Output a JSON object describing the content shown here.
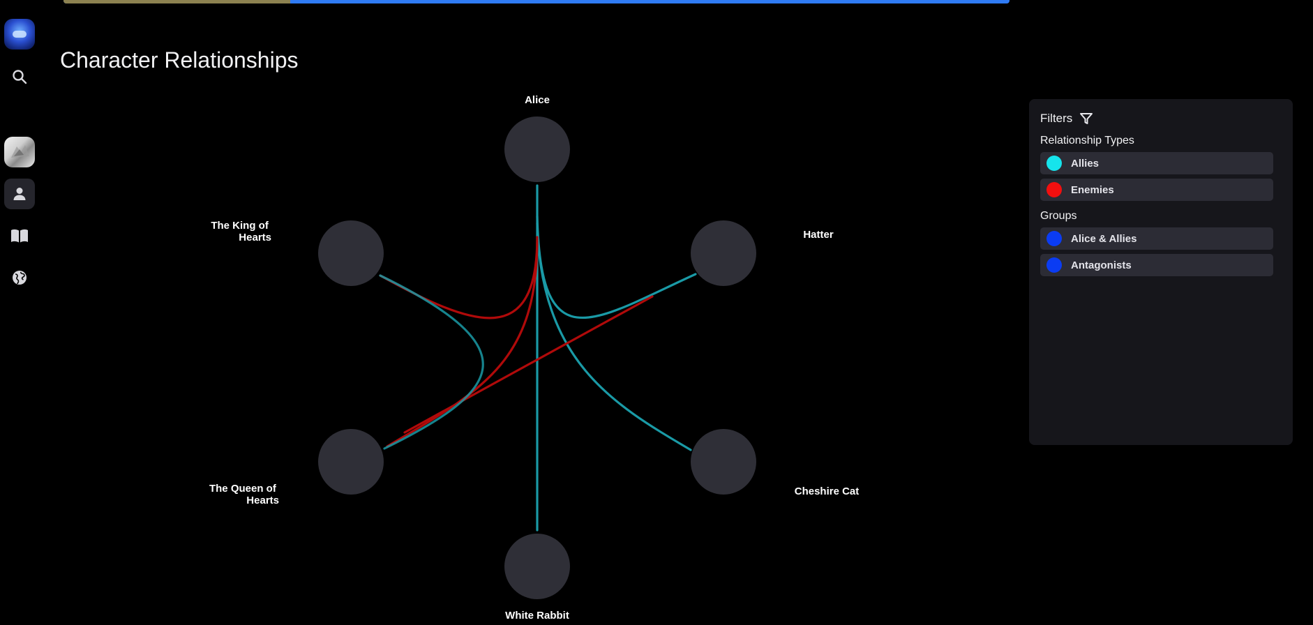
{
  "progress": {
    "value": 0.24,
    "colors": {
      "done": "#8c8150",
      "remaining": "#2f7bf5"
    }
  },
  "sidebar": {
    "items": [
      {
        "icon": "app-logo",
        "active": false
      },
      {
        "icon": "search-icon",
        "active": false
      },
      {
        "icon": "avatar-image",
        "active": false
      },
      {
        "icon": "user-icon",
        "active": true
      },
      {
        "icon": "book-icon",
        "active": false
      },
      {
        "icon": "globe-icon",
        "active": false
      }
    ]
  },
  "page": {
    "title": "Character Relationships"
  },
  "graph": {
    "nodes": [
      {
        "id": "alice",
        "label": "Alice"
      },
      {
        "id": "hatter",
        "label": "Hatter"
      },
      {
        "id": "cheshire",
        "label": "Cheshire Cat"
      },
      {
        "id": "rabbit",
        "label": "White Rabbit"
      },
      {
        "id": "queen",
        "label_lines": [
          "The Queen of",
          "Hearts"
        ]
      },
      {
        "id": "king",
        "label_lines": [
          "The King of",
          "Hearts"
        ]
      }
    ],
    "edges": [
      {
        "from": "alice",
        "to": "rabbit",
        "type": "allies"
      },
      {
        "from": "alice",
        "to": "hatter",
        "type": "allies"
      },
      {
        "from": "alice",
        "to": "cheshire",
        "type": "allies"
      },
      {
        "from": "alice",
        "to": "king",
        "type": "enemies"
      },
      {
        "from": "alice",
        "to": "queen",
        "type": "enemies"
      },
      {
        "from": "hatter",
        "to": "queen",
        "type": "enemies"
      },
      {
        "from": "king",
        "to": "queen",
        "type": "allies"
      }
    ],
    "colors": {
      "node": "#2f2f37",
      "allies": "#1a9aa6",
      "enemies": "#b00a0a"
    }
  },
  "filters": {
    "title": "Filters",
    "relationship_types_title": "Relationship Types",
    "relationship_types": [
      {
        "label": "Allies",
        "color": "#16e4ec"
      },
      {
        "label": "Enemies",
        "color": "#f20f0f"
      }
    ],
    "groups_title": "Groups",
    "groups": [
      {
        "label": "Alice & Allies",
        "color": "#0b3cf3"
      },
      {
        "label": "Antagonists",
        "color": "#0b3cf3"
      }
    ]
  }
}
